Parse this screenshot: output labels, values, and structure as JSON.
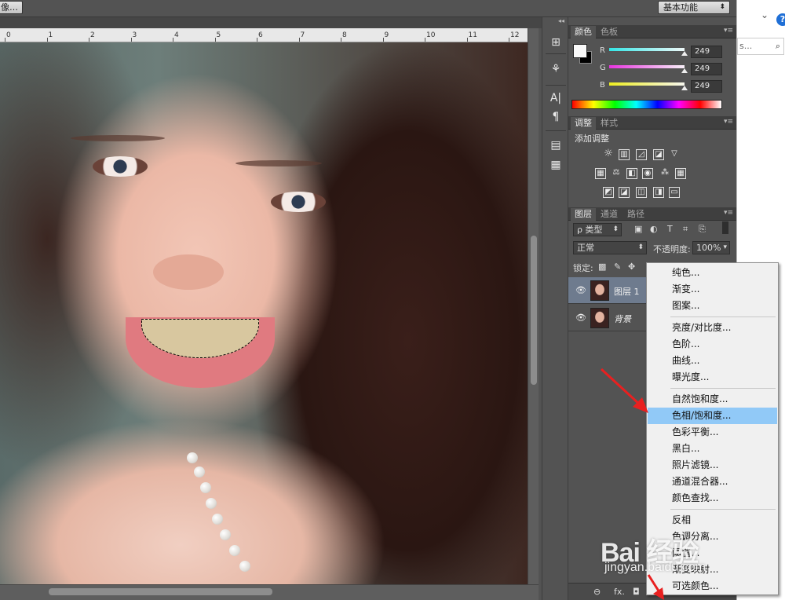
{
  "topbar": {
    "left_button": "像…",
    "workspace": "基本功能"
  },
  "outside": {
    "chevron": "⌄",
    "help": "?",
    "search_text": "s...",
    "search_icon": "magnifier-icon"
  },
  "ruler": {
    "ticks": [
      "0",
      "1",
      "2",
      "3",
      "4",
      "5",
      "6",
      "7",
      "8",
      "9",
      "10",
      "11",
      "12"
    ]
  },
  "color_panel": {
    "tabs": [
      "颜色",
      "色板"
    ],
    "channels": [
      {
        "label": "R",
        "value": "249",
        "color": "#33e5e5"
      },
      {
        "label": "G",
        "value": "249",
        "color": "#e833e0"
      },
      {
        "label": "B",
        "value": "249",
        "color": "#eded20"
      }
    ],
    "foreground": "#f9f9f9",
    "background": "#000000"
  },
  "adjust_panel": {
    "tabs": [
      "调整",
      "样式"
    ],
    "add_label": "添加调整"
  },
  "layers_panel": {
    "tabs": [
      "图层",
      "通道",
      "路径"
    ],
    "filter_kind": "ρ 类型",
    "blend_mode": "正常",
    "opacity_label": "不透明度:",
    "opacity_value": "100%",
    "lock_label": "锁定:",
    "layers": [
      {
        "name": "图层 1",
        "selected": true
      },
      {
        "name": "背景",
        "selected": false
      }
    ],
    "bottom_icons": [
      "⊖",
      "fx."
    ]
  },
  "context_menu": {
    "groups": [
      [
        "纯色...",
        "渐变...",
        "图案..."
      ],
      [
        "亮度/对比度...",
        "色阶...",
        "曲线...",
        "曝光度..."
      ],
      [
        "自然饱和度...",
        "色相/饱和度...",
        "色彩平衡...",
        "黑白...",
        "照片滤镜...",
        "通道混合器...",
        "颜色查找..."
      ],
      [
        "反相",
        "色调分离...",
        "阈值...",
        "渐变映射...",
        "可选颜色..."
      ]
    ],
    "highlighted": "色相/饱和度..."
  },
  "watermark": {
    "brand": "Bai 经验",
    "sub": "jingyan.baidu.com"
  }
}
